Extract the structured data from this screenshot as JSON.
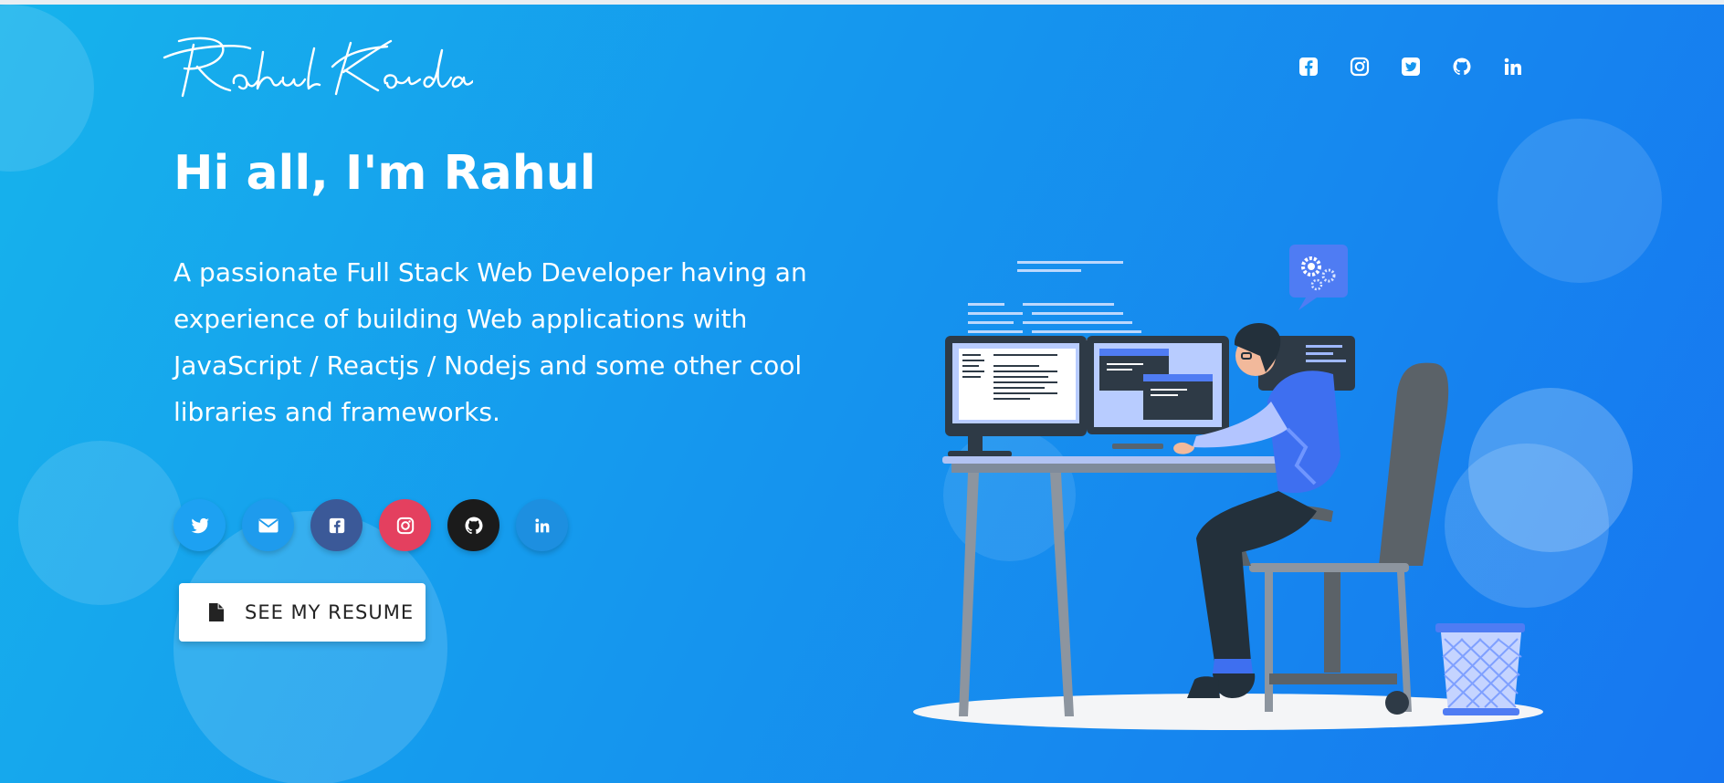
{
  "colors": {
    "twitter": "#1da1f2",
    "email": "#1e9bed",
    "facebook": "#3b5998",
    "instagram": "#e4405f",
    "github": "#1b1b1b",
    "linkedin": "#1d8fe0"
  },
  "header": {
    "logo_alt": "Rahul Konda",
    "social_icons": [
      "facebook-icon",
      "instagram-icon",
      "twitter-icon",
      "github-icon",
      "linkedin-icon"
    ]
  },
  "hero": {
    "greeting": "Hi all, I'm Rahul",
    "bio": "A passionate Full Stack Web Developer having an experience of building Web applications with JavaScript / Reactjs / Nodejs and some other cool libraries and frameworks.",
    "social_buttons": [
      "twitter",
      "email",
      "facebook",
      "instagram",
      "github",
      "linkedin"
    ],
    "resume_button": "SEE MY RESUME"
  }
}
